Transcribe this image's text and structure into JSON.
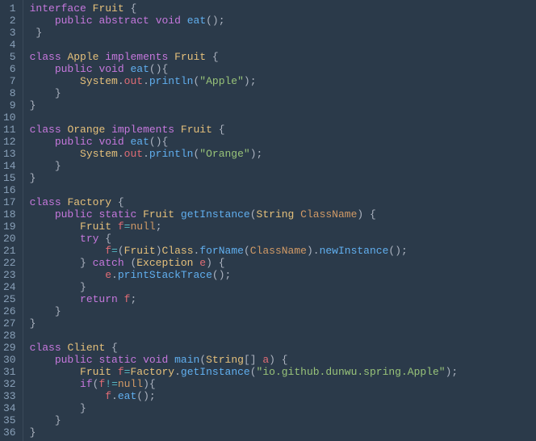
{
  "lines": [
    {
      "n": "1",
      "tokens": [
        {
          "t": "interface",
          "c": "kw"
        },
        {
          "t": " ",
          "c": "plain"
        },
        {
          "t": "Fruit",
          "c": "type"
        },
        {
          "t": " {",
          "c": "punct"
        }
      ]
    },
    {
      "n": "2",
      "tokens": [
        {
          "t": "    ",
          "c": "plain"
        },
        {
          "t": "public",
          "c": "kw"
        },
        {
          "t": " ",
          "c": "plain"
        },
        {
          "t": "abstract",
          "c": "kw"
        },
        {
          "t": " ",
          "c": "plain"
        },
        {
          "t": "void",
          "c": "kw"
        },
        {
          "t": " ",
          "c": "plain"
        },
        {
          "t": "eat",
          "c": "fn"
        },
        {
          "t": "();",
          "c": "punct"
        }
      ]
    },
    {
      "n": "3",
      "tokens": [
        {
          "t": " }",
          "c": "punct"
        }
      ]
    },
    {
      "n": "4",
      "tokens": []
    },
    {
      "n": "5",
      "tokens": [
        {
          "t": "class",
          "c": "kw"
        },
        {
          "t": " ",
          "c": "plain"
        },
        {
          "t": "Apple",
          "c": "type"
        },
        {
          "t": " ",
          "c": "plain"
        },
        {
          "t": "implements",
          "c": "kw"
        },
        {
          "t": " ",
          "c": "plain"
        },
        {
          "t": "Fruit",
          "c": "type"
        },
        {
          "t": " {",
          "c": "punct"
        }
      ]
    },
    {
      "n": "6",
      "tokens": [
        {
          "t": "    ",
          "c": "plain"
        },
        {
          "t": "public",
          "c": "kw"
        },
        {
          "t": " ",
          "c": "plain"
        },
        {
          "t": "void",
          "c": "kw"
        },
        {
          "t": " ",
          "c": "plain"
        },
        {
          "t": "eat",
          "c": "fn"
        },
        {
          "t": "(){",
          "c": "punct"
        }
      ]
    },
    {
      "n": "7",
      "tokens": [
        {
          "t": "        ",
          "c": "plain"
        },
        {
          "t": "System",
          "c": "type"
        },
        {
          "t": ".",
          "c": "punct"
        },
        {
          "t": "out",
          "c": "var"
        },
        {
          "t": ".",
          "c": "punct"
        },
        {
          "t": "println",
          "c": "fn"
        },
        {
          "t": "(",
          "c": "punct"
        },
        {
          "t": "\"Apple\"",
          "c": "str"
        },
        {
          "t": ");",
          "c": "punct"
        }
      ]
    },
    {
      "n": "8",
      "tokens": [
        {
          "t": "    }",
          "c": "punct"
        }
      ]
    },
    {
      "n": "9",
      "tokens": [
        {
          "t": "}",
          "c": "punct"
        }
      ]
    },
    {
      "n": "10",
      "tokens": []
    },
    {
      "n": "11",
      "tokens": [
        {
          "t": "class",
          "c": "kw"
        },
        {
          "t": " ",
          "c": "plain"
        },
        {
          "t": "Orange",
          "c": "type"
        },
        {
          "t": " ",
          "c": "plain"
        },
        {
          "t": "implements",
          "c": "kw"
        },
        {
          "t": " ",
          "c": "plain"
        },
        {
          "t": "Fruit",
          "c": "type"
        },
        {
          "t": " {",
          "c": "punct"
        }
      ]
    },
    {
      "n": "12",
      "tokens": [
        {
          "t": "    ",
          "c": "plain"
        },
        {
          "t": "public",
          "c": "kw"
        },
        {
          "t": " ",
          "c": "plain"
        },
        {
          "t": "void",
          "c": "kw"
        },
        {
          "t": " ",
          "c": "plain"
        },
        {
          "t": "eat",
          "c": "fn"
        },
        {
          "t": "(){",
          "c": "punct"
        }
      ]
    },
    {
      "n": "13",
      "tokens": [
        {
          "t": "        ",
          "c": "plain"
        },
        {
          "t": "System",
          "c": "type"
        },
        {
          "t": ".",
          "c": "punct"
        },
        {
          "t": "out",
          "c": "var"
        },
        {
          "t": ".",
          "c": "punct"
        },
        {
          "t": "println",
          "c": "fn"
        },
        {
          "t": "(",
          "c": "punct"
        },
        {
          "t": "\"Orange\"",
          "c": "str"
        },
        {
          "t": ");",
          "c": "punct"
        }
      ]
    },
    {
      "n": "14",
      "tokens": [
        {
          "t": "    }",
          "c": "punct"
        }
      ]
    },
    {
      "n": "15",
      "tokens": [
        {
          "t": "}",
          "c": "punct"
        }
      ]
    },
    {
      "n": "16",
      "tokens": []
    },
    {
      "n": "17",
      "tokens": [
        {
          "t": "class",
          "c": "kw"
        },
        {
          "t": " ",
          "c": "plain"
        },
        {
          "t": "Factory",
          "c": "type"
        },
        {
          "t": " {",
          "c": "punct"
        }
      ]
    },
    {
      "n": "18",
      "tokens": [
        {
          "t": "    ",
          "c": "plain"
        },
        {
          "t": "public",
          "c": "kw"
        },
        {
          "t": " ",
          "c": "plain"
        },
        {
          "t": "static",
          "c": "kw"
        },
        {
          "t": " ",
          "c": "plain"
        },
        {
          "t": "Fruit",
          "c": "type"
        },
        {
          "t": " ",
          "c": "plain"
        },
        {
          "t": "getInstance",
          "c": "fn"
        },
        {
          "t": "(",
          "c": "punct"
        },
        {
          "t": "String",
          "c": "type"
        },
        {
          "t": " ",
          "c": "plain"
        },
        {
          "t": "ClassName",
          "c": "param"
        },
        {
          "t": ") {",
          "c": "punct"
        }
      ]
    },
    {
      "n": "19",
      "tokens": [
        {
          "t": "        ",
          "c": "plain"
        },
        {
          "t": "Fruit",
          "c": "type"
        },
        {
          "t": " ",
          "c": "plain"
        },
        {
          "t": "f",
          "c": "var"
        },
        {
          "t": "=",
          "c": "op"
        },
        {
          "t": "null",
          "c": "param"
        },
        {
          "t": ";",
          "c": "punct"
        }
      ]
    },
    {
      "n": "20",
      "tokens": [
        {
          "t": "        ",
          "c": "plain"
        },
        {
          "t": "try",
          "c": "kw"
        },
        {
          "t": " {",
          "c": "punct"
        }
      ]
    },
    {
      "n": "21",
      "tokens": [
        {
          "t": "            ",
          "c": "plain"
        },
        {
          "t": "f",
          "c": "var"
        },
        {
          "t": "=",
          "c": "op"
        },
        {
          "t": "(",
          "c": "punct"
        },
        {
          "t": "Fruit",
          "c": "type"
        },
        {
          "t": ")",
          "c": "punct"
        },
        {
          "t": "Class",
          "c": "type"
        },
        {
          "t": ".",
          "c": "punct"
        },
        {
          "t": "forName",
          "c": "fn"
        },
        {
          "t": "(",
          "c": "punct"
        },
        {
          "t": "ClassName",
          "c": "param"
        },
        {
          "t": ").",
          "c": "punct"
        },
        {
          "t": "newInstance",
          "c": "fn"
        },
        {
          "t": "();",
          "c": "punct"
        }
      ]
    },
    {
      "n": "22",
      "tokens": [
        {
          "t": "        } ",
          "c": "punct"
        },
        {
          "t": "catch",
          "c": "kw"
        },
        {
          "t": " (",
          "c": "punct"
        },
        {
          "t": "Exception",
          "c": "type"
        },
        {
          "t": " ",
          "c": "plain"
        },
        {
          "t": "e",
          "c": "var"
        },
        {
          "t": ") {",
          "c": "punct"
        }
      ]
    },
    {
      "n": "23",
      "tokens": [
        {
          "t": "            ",
          "c": "plain"
        },
        {
          "t": "e",
          "c": "var"
        },
        {
          "t": ".",
          "c": "punct"
        },
        {
          "t": "printStackTrace",
          "c": "fn"
        },
        {
          "t": "();",
          "c": "punct"
        }
      ]
    },
    {
      "n": "24",
      "tokens": [
        {
          "t": "        }",
          "c": "punct"
        }
      ]
    },
    {
      "n": "25",
      "tokens": [
        {
          "t": "        ",
          "c": "plain"
        },
        {
          "t": "return",
          "c": "kw"
        },
        {
          "t": " ",
          "c": "plain"
        },
        {
          "t": "f",
          "c": "var"
        },
        {
          "t": ";",
          "c": "punct"
        }
      ]
    },
    {
      "n": "26",
      "tokens": [
        {
          "t": "    }",
          "c": "punct"
        }
      ]
    },
    {
      "n": "27",
      "tokens": [
        {
          "t": "}",
          "c": "punct"
        }
      ]
    },
    {
      "n": "28",
      "tokens": []
    },
    {
      "n": "29",
      "tokens": [
        {
          "t": "class",
          "c": "kw"
        },
        {
          "t": " ",
          "c": "plain"
        },
        {
          "t": "Client",
          "c": "type"
        },
        {
          "t": " {",
          "c": "punct"
        }
      ]
    },
    {
      "n": "30",
      "tokens": [
        {
          "t": "    ",
          "c": "plain"
        },
        {
          "t": "public",
          "c": "kw"
        },
        {
          "t": " ",
          "c": "plain"
        },
        {
          "t": "static",
          "c": "kw"
        },
        {
          "t": " ",
          "c": "plain"
        },
        {
          "t": "void",
          "c": "kw"
        },
        {
          "t": " ",
          "c": "plain"
        },
        {
          "t": "main",
          "c": "fn"
        },
        {
          "t": "(",
          "c": "punct"
        },
        {
          "t": "String",
          "c": "type"
        },
        {
          "t": "[] ",
          "c": "punct"
        },
        {
          "t": "a",
          "c": "var"
        },
        {
          "t": ") {",
          "c": "punct"
        }
      ]
    },
    {
      "n": "31",
      "tokens": [
        {
          "t": "        ",
          "c": "plain"
        },
        {
          "t": "Fruit",
          "c": "type"
        },
        {
          "t": " ",
          "c": "plain"
        },
        {
          "t": "f",
          "c": "var"
        },
        {
          "t": "=",
          "c": "op"
        },
        {
          "t": "Factory",
          "c": "type"
        },
        {
          "t": ".",
          "c": "punct"
        },
        {
          "t": "getInstance",
          "c": "fn"
        },
        {
          "t": "(",
          "c": "punct"
        },
        {
          "t": "\"io.github.dunwu.spring.Apple\"",
          "c": "str"
        },
        {
          "t": ");",
          "c": "punct"
        }
      ]
    },
    {
      "n": "32",
      "tokens": [
        {
          "t": "        ",
          "c": "plain"
        },
        {
          "t": "if",
          "c": "kw"
        },
        {
          "t": "(",
          "c": "punct"
        },
        {
          "t": "f",
          "c": "var"
        },
        {
          "t": "!=",
          "c": "op"
        },
        {
          "t": "null",
          "c": "param"
        },
        {
          "t": "){",
          "c": "punct"
        }
      ]
    },
    {
      "n": "33",
      "tokens": [
        {
          "t": "            ",
          "c": "plain"
        },
        {
          "t": "f",
          "c": "var"
        },
        {
          "t": ".",
          "c": "punct"
        },
        {
          "t": "eat",
          "c": "fn"
        },
        {
          "t": "();",
          "c": "punct"
        }
      ]
    },
    {
      "n": "34",
      "tokens": [
        {
          "t": "        }",
          "c": "punct"
        }
      ]
    },
    {
      "n": "35",
      "tokens": [
        {
          "t": "    }",
          "c": "punct"
        }
      ]
    },
    {
      "n": "36",
      "tokens": [
        {
          "t": "}",
          "c": "punct"
        }
      ]
    }
  ]
}
